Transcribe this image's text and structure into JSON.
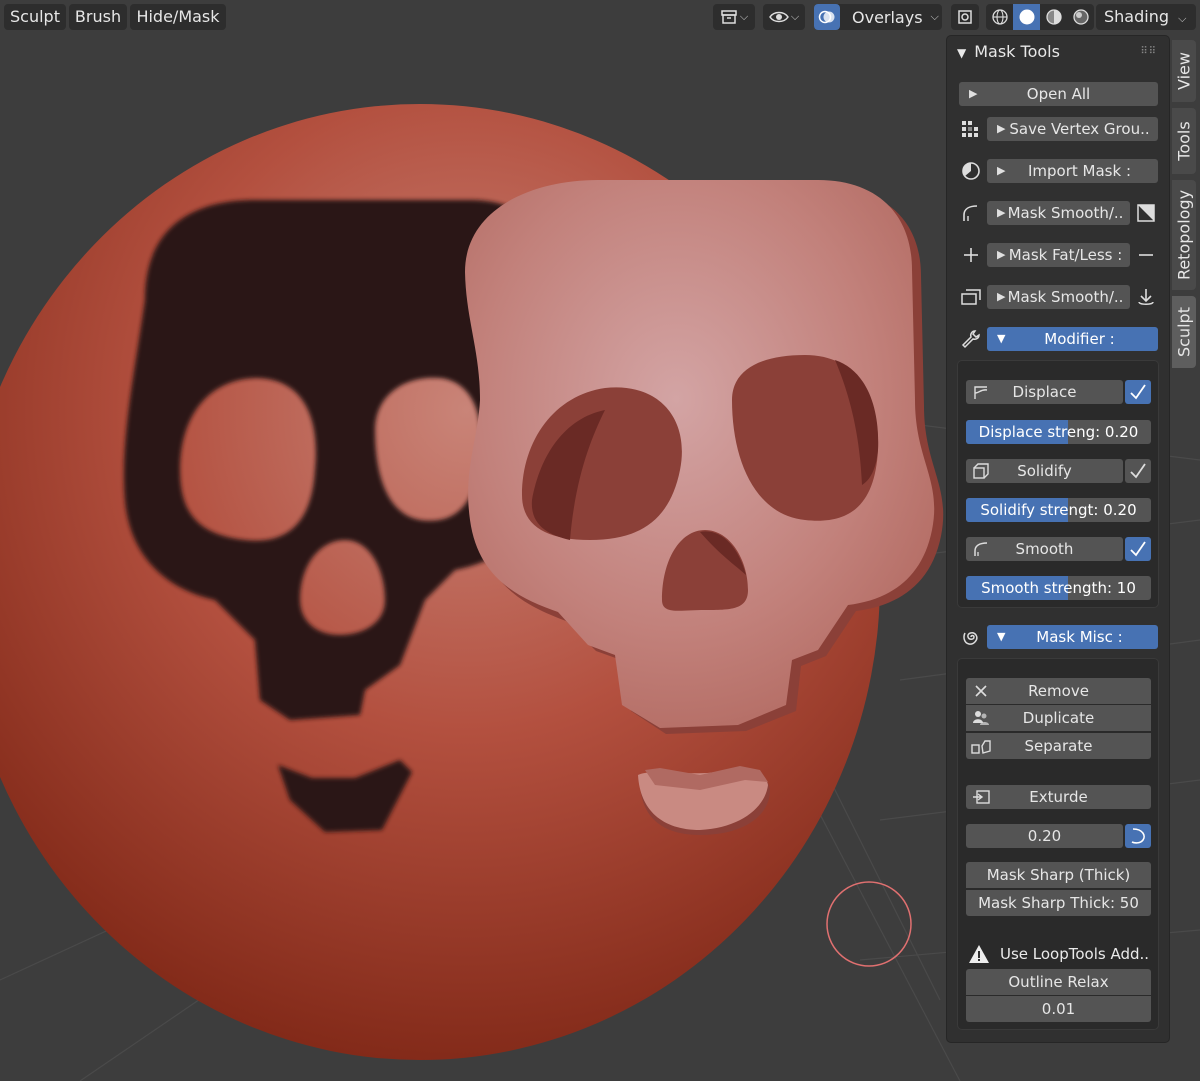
{
  "header": {
    "menus": [
      "Sculpt",
      "Brush",
      "Hide/Mask"
    ],
    "overlays_label": "Overlays",
    "shading_label": "Shading"
  },
  "panel": {
    "title": "Mask Tools",
    "open_all": "Open All",
    "sections": [
      {
        "label": "Save Vertex Grou..",
        "icon": "vertex-group-icon"
      },
      {
        "label": "Import Mask :",
        "icon": "mask-import-icon"
      },
      {
        "label": "Mask Smooth/..",
        "icon": "curve-icon"
      },
      {
        "label": "Mask Fat/Less :",
        "icon": "plus-icon"
      },
      {
        "label": "Mask Smooth/..",
        "icon": "mask-layer-icon"
      }
    ],
    "modifier": {
      "header": "Modifier :",
      "displace": {
        "label": "Displace",
        "checked": true
      },
      "displace_strength": {
        "label": "Displace streng: 0.20",
        "fraction": 0.55
      },
      "solidify": {
        "label": "Solidify",
        "checked": false
      },
      "solidify_strength": {
        "label": "Solidify strengt:  0.20",
        "fraction": 0.55
      },
      "smooth": {
        "label": "Smooth",
        "checked": true
      },
      "smooth_strength": {
        "label": "Smooth strength:  10",
        "fraction": 0.55
      }
    },
    "mask_misc": {
      "header": "Mask Misc :",
      "remove": "Remove",
      "duplicate": "Duplicate",
      "separate": "Separate",
      "exturde": "Exturde",
      "extrude_value": "0.20",
      "mask_sharp": "Mask Sharp (Thick)",
      "mask_sharp_thick": "Mask Sharp Thick: 50",
      "warning": "Use LoopTools Add..",
      "outline_relax": "Outline Relax",
      "outline_value": "0.01"
    }
  },
  "tabs": [
    "View",
    "Tools",
    "Retopology",
    "Sculpt"
  ],
  "colors": {
    "accent": "#4772b3",
    "panel": "#303030",
    "button": "#545454",
    "sphere": "#b0483a"
  }
}
